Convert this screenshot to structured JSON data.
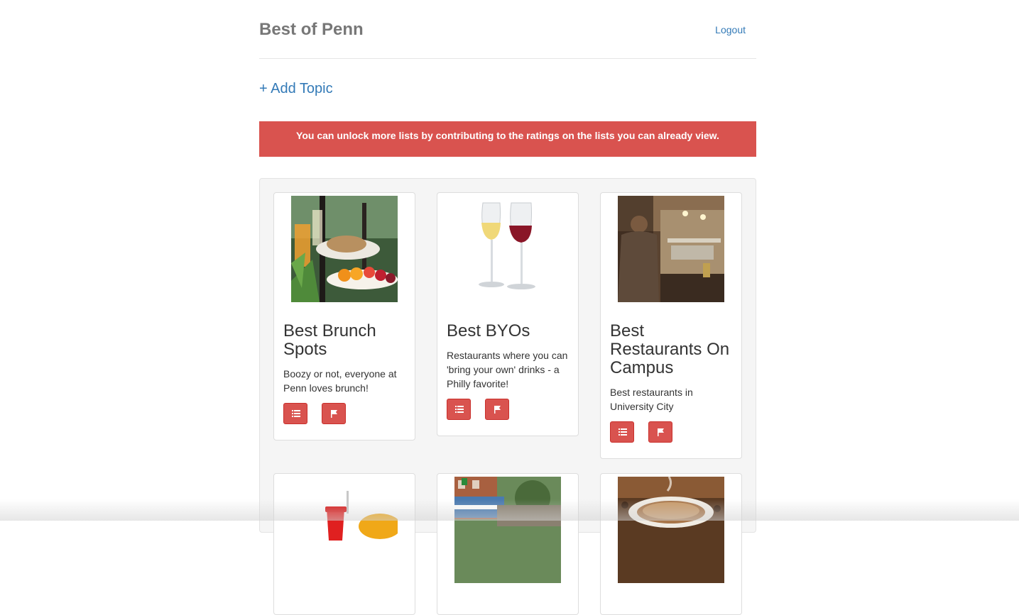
{
  "header": {
    "brand": "Best of Penn",
    "logout": "Logout"
  },
  "add_topic": "+ Add Topic",
  "alert": {
    "message": "You can unlock more lists by contributing to the ratings on the lists you can already view."
  },
  "topics": [
    {
      "title": "Best Brunch Spots",
      "description": "Boozy or not, everyone at Penn loves brunch!",
      "image": "brunch-plate"
    },
    {
      "title": "Best BYOs",
      "description": "Restaurants where you can 'bring your own' drinks - a Philly favorite!",
      "image": "wine-glasses"
    },
    {
      "title": "Best Restaurants On Campus",
      "description": "Best restaurants in University City",
      "image": "restaurant-kitchen"
    },
    {
      "image": "fast-food"
    },
    {
      "image": "food-truck-street"
    },
    {
      "image": "coffee-cup"
    }
  ],
  "icons": {
    "list": "list-icon",
    "flag": "flag-icon"
  },
  "colors": {
    "brand": "#777777",
    "link": "#337ab7",
    "danger": "#d9534f",
    "well": "#f5f5f5"
  }
}
